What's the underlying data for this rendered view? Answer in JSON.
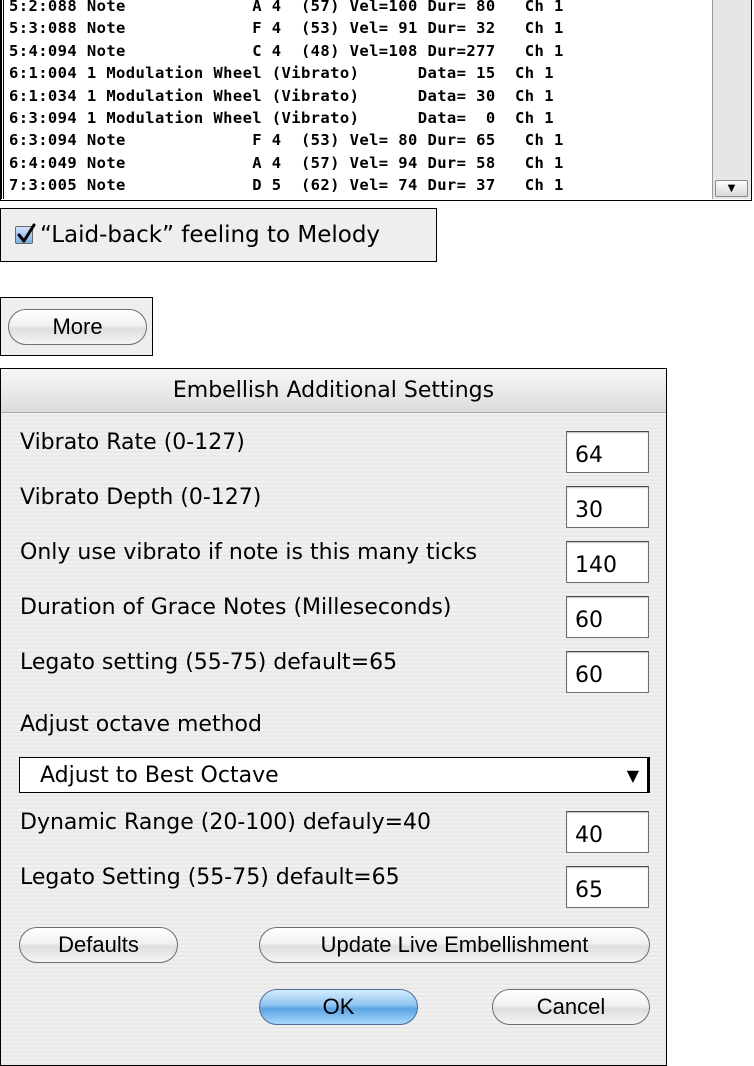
{
  "event_list": {
    "rows": [
      "5:2:088 Note             A 4  (57) Vel=100 Dur= 80   Ch 1",
      "5:3:088 Note             F 4  (53) Vel= 91 Dur= 32   Ch 1",
      "5:4:094 Note             C 4  (48) Vel=108 Dur=277   Ch 1",
      "6:1:004 1 Modulation Wheel (Vibrato)      Data= 15  Ch 1",
      "6:1:034 1 Modulation Wheel (Vibrato)      Data= 30  Ch 1",
      "6:3:094 1 Modulation Wheel (Vibrato)      Data=  0  Ch 1",
      "6:3:094 Note             F 4  (53) Vel= 80 Dur= 65   Ch 1",
      "6:4:049 Note             A 4  (57) Vel= 94 Dur= 58   Ch 1",
      "7:3:005 Note             D 5  (62) Vel= 74 Dur= 37   Ch 1"
    ]
  },
  "laidback": {
    "label": "“Laid-back” feeling to Melody",
    "checked": true
  },
  "more_button": {
    "label": "More"
  },
  "dialog": {
    "title": "Embellish Additional Settings",
    "vibrato_rate": {
      "label": "Vibrato Rate (0-127)",
      "value": "64"
    },
    "vibrato_depth": {
      "label": "Vibrato Depth (0-127)",
      "value": "30"
    },
    "vibrato_ticks": {
      "label": "Only use vibrato if note is this many ticks",
      "value": "140"
    },
    "grace_duration": {
      "label": "Duration of Grace Notes (Milleseconds)",
      "value": "60"
    },
    "legato_1": {
      "label": "Legato setting (55-75) default=65",
      "value": "60"
    },
    "octave_method": {
      "label": "Adjust octave method",
      "selected": "Adjust to Best Octave"
    },
    "dynamic_range": {
      "label": "Dynamic Range (20-100) defauly=40",
      "value": "40"
    },
    "legato_2": {
      "label": "Legato Setting (55-75) default=65",
      "value": "65"
    },
    "buttons": {
      "defaults": "Defaults",
      "update_live": "Update Live Embellishment",
      "ok": "OK",
      "cancel": "Cancel"
    }
  },
  "colors": {
    "checkbox_accent": "#7fb0e6",
    "default_button_blue": "#5aa3e2"
  }
}
